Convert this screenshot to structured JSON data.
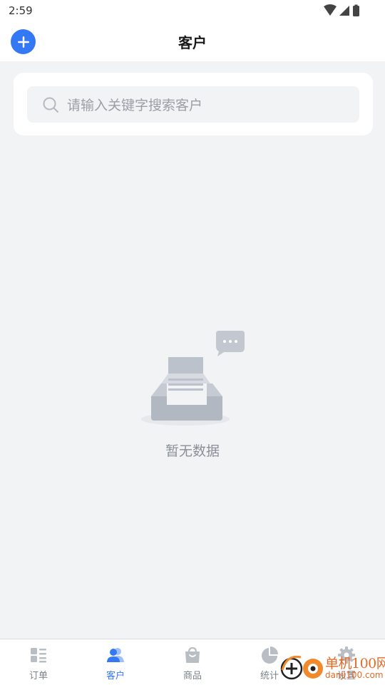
{
  "status": {
    "time": "2:59"
  },
  "header": {
    "title": "客户"
  },
  "search": {
    "placeholder": "请输入关键字搜索客户"
  },
  "empty": {
    "text": "暂无数据"
  },
  "tabs": [
    {
      "label": "订单",
      "icon": "list-icon"
    },
    {
      "label": "客户",
      "icon": "users-icon",
      "active": true
    },
    {
      "label": "商品",
      "icon": "bag-icon"
    },
    {
      "label": "统计",
      "icon": "pie-chart-icon"
    },
    {
      "label": "设置",
      "icon": "gear-icon"
    }
  ],
  "watermark": {
    "text": "单机100网",
    "sub": "danji100.com"
  },
  "colors": {
    "accent": "#3478f6",
    "background": "#f2f3f5",
    "watermark": "#e86a24"
  }
}
